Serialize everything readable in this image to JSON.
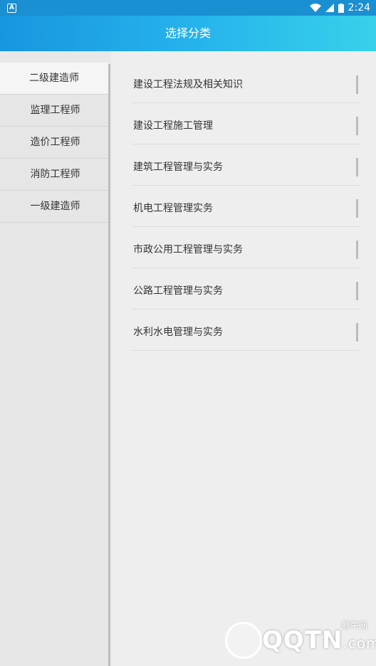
{
  "status_bar": {
    "time": "2:24",
    "notification_icon": "A"
  },
  "header": {
    "title": "选择分类"
  },
  "sidebar": {
    "items": [
      {
        "label": "二级建造师",
        "active": true
      },
      {
        "label": "监理工程师",
        "active": false
      },
      {
        "label": "造价工程师",
        "active": false
      },
      {
        "label": "消防工程师",
        "active": false
      },
      {
        "label": "一级建造师",
        "active": false
      }
    ]
  },
  "content": {
    "items": [
      {
        "label": "建设工程法规及相关知识"
      },
      {
        "label": "建设工程施工管理"
      },
      {
        "label": "建筑工程管理与实务"
      },
      {
        "label": "机电工程管理实务"
      },
      {
        "label": "市政公用工程管理与实务"
      },
      {
        "label": "公路工程管理与实务"
      },
      {
        "label": "水利水电管理与实务"
      }
    ]
  },
  "watermark": {
    "brand": "QQTN",
    "suffix": ".com",
    "cn": "腾牛网"
  },
  "colors": {
    "header_start": "#1796e0",
    "header_end": "#37d1ea",
    "status_bar": "#1a8fd1"
  }
}
